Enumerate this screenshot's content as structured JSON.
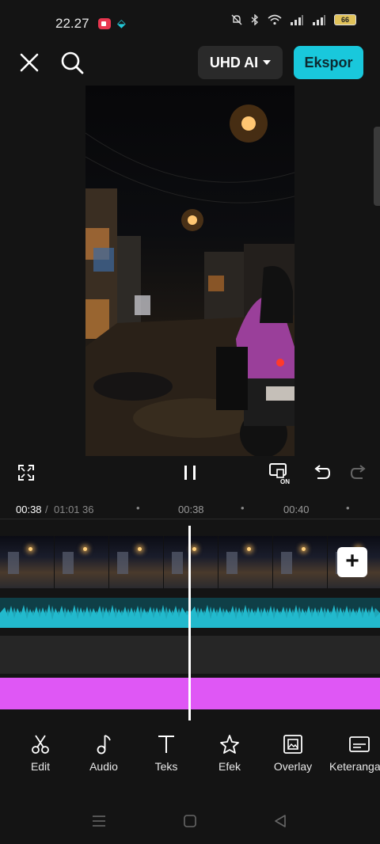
{
  "status_bar": {
    "time": "22.27",
    "battery": "66"
  },
  "top_bar": {
    "quality_label": "UHD AI",
    "export_label": "Ekspor"
  },
  "preview": {
    "description_icons": [
      "street-scene"
    ]
  },
  "timeline": {
    "current_time": "00:38",
    "separator": " / ",
    "total_time": "01:01",
    "tick_partial": "36",
    "tick_1": "00:38",
    "tick_2": "00:40"
  },
  "toolbar": {
    "items": [
      {
        "label": "Edit",
        "icon": "scissors-icon"
      },
      {
        "label": "Audio",
        "icon": "music-note-icon"
      },
      {
        "label": "Teks",
        "icon": "text-icon"
      },
      {
        "label": "Efek",
        "icon": "sparkle-star-icon"
      },
      {
        "label": "Overlay",
        "icon": "overlay-image-icon"
      },
      {
        "label": "Keteranga",
        "icon": "caption-icon"
      }
    ]
  },
  "colors": {
    "accent": "#19c8dc",
    "audio_wave": "#22b9cc",
    "text_track": "#df57f5",
    "background": "#141414"
  }
}
